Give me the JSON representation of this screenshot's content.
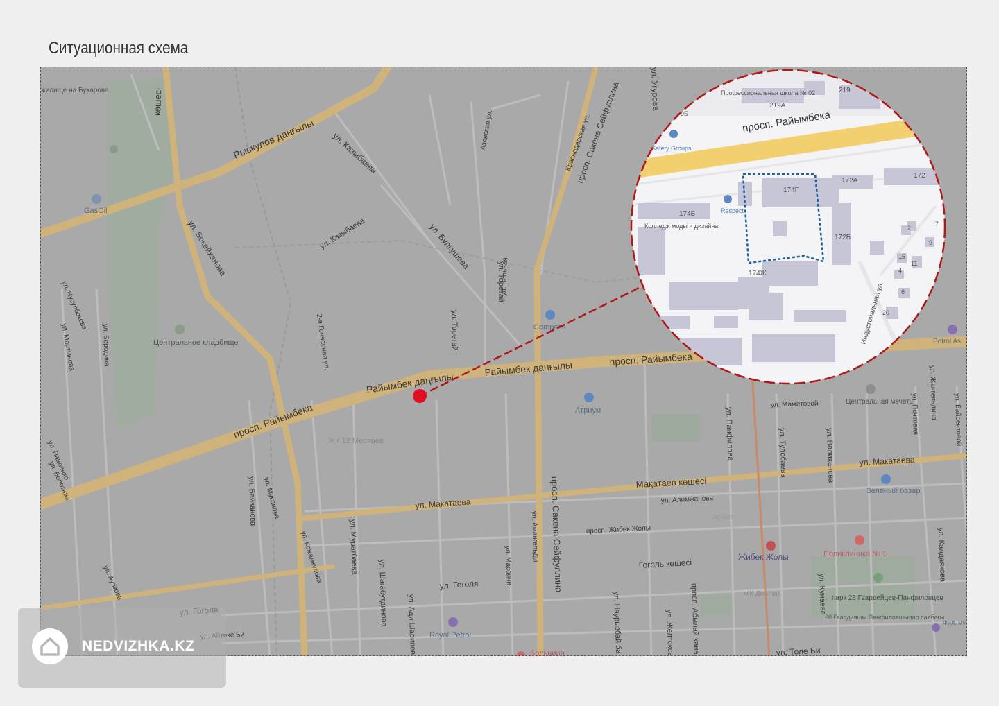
{
  "page": {
    "title": "Ситуационная схема",
    "watermark": "NEDVIZHKA.KZ"
  },
  "map": {
    "streets": {
      "raiymbek_kz": "Райымбек даңғылы",
      "raiymbek_kz2": "Райымбек даңғылы",
      "raiymbek_ru": "просп. Райымбека",
      "raiymbek_ru2": "просп. Райымбека",
      "ryskulov": "Рыскулов даңғылы",
      "kazybaeva1": "ул. Казыбаева",
      "kazybaeva2": "ул. Казыбаева",
      "bulkusheva": "ул. Булкушева",
      "toretai1": "ул. Торетай",
      "toretai2": "ул. Торетай",
      "bokeikhanova": "ул. Бокейханова",
      "seifullina1": "просп. Сакена Сейфуллина",
      "seifullina2": "просп. Сакена Сейфуллина",
      "makataeva1": "ул. Макатаева",
      "makataeva2": "ул. Макатаева",
      "makataeva_kz": "Мақатаев көшесі",
      "zhibek_zholy": "просп. Жибек Жолы",
      "gogolya1": "ул. Гоголя",
      "gogolya2": "ул. Гоголя",
      "gogol_kz": "Гоголь көшесі",
      "baizakova": "ул. Байзакова",
      "muratbaeva": "ул. Муратбаева",
      "shagabutdinova": "ул. Шагабутдинова",
      "adi_sharipova": "ул. Ади Шарипова",
      "naurizbai": "ул. Наурызбай батыра",
      "zheltoksan": "ул. Желтоксан",
      "abylai": "просп. Абылай хана",
      "panfilova": "ул. Панфилова",
      "tulebaeva": "ул. Тулебаева",
      "valikhanova": "ул. Валиханова",
      "kunaeva": "ул. Кунаева",
      "kaldayakova": "ул. Калдаякова",
      "tole_bi": "ул. Толе Би",
      "aiteke_bi": "ул. Айтеке Би",
      "mametovoi": "ул. Маметовой",
      "alimzhanova": "ул. Алимжанова",
      "gончарная": "2-я Гончарная ул.",
      "zhangeldin": "ул. Жангельдина",
      "pochtovaya": "ул. Почтовая",
      "baisetova": "ул. Байсеитовой",
      "ugurova": "ул. Угурова",
      "mukanova": "ул. Муканова",
      "pavlenko": "ул. Павленко",
      "bolotnaya": "ул. Болотная",
      "nuazbekova": "ул. Нусупбекова",
      "martynova": "ул. Мартынова",
      "borodina": "ул. Бородина",
      "kozhamkulova": "ул. Кожамкулова",
      "auezova": "ул. Ауэзова",
      "masanchi": "ул. Масанчи",
      "amangeldy": "ул. Амангельды",
      "koshechi": "көшесі",
      "volnaya": "ул. Вольная",
      "azovskaya": "Азовская ул.",
      "krasnodarskaya": "Краснодарская ул.",
      "zhambyla": "ул. Жамбыла"
    },
    "pois": {
      "gasoil": "GasOil",
      "cemetery": "Центральное кладбище",
      "compass": "Compass",
      "atrium": "Атриум",
      "zk12": "ЖК 12 Месяцев",
      "central_mosque": "Центральная мечеть",
      "zelenyi_bazar": "Зелёный базар",
      "arbat": "Арбат",
      "zhibek_zholy_metro": "Жибек Жолы",
      "zk_dilan": "ЖК Диалан",
      "poliklinika": "Поликлиника № 1",
      "park28": "парк 28 Гвардейцев-Панфиловцев",
      "park28_kz": "28 Гвардияшы Панфиловшылар саябағы",
      "royal_petrol": "Royal Petrol",
      "bolnitsa": "Больница",
      "petrol_as": "Petrol As",
      "filmmuseum": "Фил. муз.",
      "zhbaba": "жилище на Бухарова"
    },
    "inset": {
      "street_main": "просп. Райымбека",
      "safety_groups": "Safety Groups",
      "school": "Профессиональная школа № 02",
      "college": "Колледж моды и дизайна",
      "respect": "Respect",
      "industrial": "Индустриальная ул.",
      "b219": "219",
      "b219a": "219А",
      "b174g": "174Г",
      "b174b": "174Б",
      "b172a": "172А",
      "b172": "172",
      "b172b": "172Б",
      "b174zh": "174Ж",
      "n2": "2",
      "n7": "7",
      "n9": "9",
      "n15": "15",
      "n4": "4",
      "n11": "11",
      "n6": "6",
      "n20": "20",
      "b9b": "9Б"
    },
    "colors": {
      "map_bg": "#aeaeae",
      "road_major": "#d8b877",
      "road_minor": "#c6c6c6",
      "marker": "#e01020",
      "inset_circle": "#b01818",
      "inset_plot": "#1a5ea0",
      "poi": "#4a79b8"
    },
    "marker_icon": "location-dot-icon"
  }
}
